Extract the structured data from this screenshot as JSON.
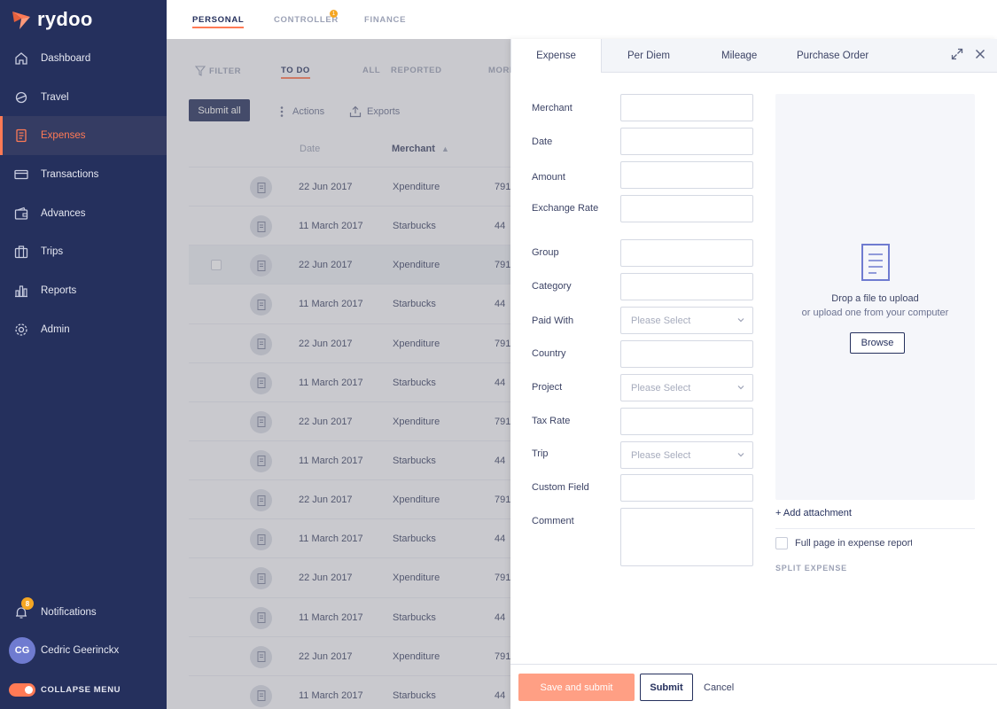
{
  "app": {
    "logo_text": "rydoo",
    "brand_color": "#ff7a55",
    "sidebar_color": "#25305d"
  },
  "sidebar": {
    "items": [
      {
        "label": "Dashboard",
        "icon": "home-icon"
      },
      {
        "label": "Travel",
        "icon": "travel-icon"
      },
      {
        "label": "Expenses",
        "icon": "expenses-icon",
        "active": true
      },
      {
        "label": "Transactions",
        "icon": "card-icon"
      },
      {
        "label": "Advances",
        "icon": "wallet-icon"
      },
      {
        "label": "Trips",
        "icon": "suitcase-icon"
      },
      {
        "label": "Reports",
        "icon": "bar-chart-icon"
      },
      {
        "label": "Admin",
        "icon": "gear-icon"
      }
    ],
    "notifications_label": "Notifications",
    "notifications_count": "8",
    "user_initials": "CG",
    "user_name": "Cedric Geerinckx",
    "collapse_label": "COLLAPSE MENU"
  },
  "top_tabs": [
    {
      "label": "PERSONAL",
      "active": true
    },
    {
      "label": "CONTROLLER",
      "badge": "1"
    },
    {
      "label": "FINANCE"
    }
  ],
  "list": {
    "filter_label": "FILTER",
    "subtabs": [
      "TO DO",
      "ALL",
      "REPORTED",
      "MORE"
    ],
    "submit_all": "Submit all",
    "actions": "Actions",
    "exports": "Exports",
    "columns": {
      "date": "Date",
      "merchant": "Merchant"
    },
    "rows": [
      {
        "date": "22 Jun 2017",
        "merchant": "Xpenditure",
        "amount": "791"
      },
      {
        "date": "11 March 2017",
        "merchant": "Starbucks",
        "amount": "44"
      },
      {
        "date": "22 Jun 2017",
        "merchant": "Xpenditure",
        "amount": "791"
      },
      {
        "date": "11 March 2017",
        "merchant": "Starbucks",
        "amount": "44"
      },
      {
        "date": "22 Jun 2017",
        "merchant": "Xpenditure",
        "amount": "791"
      },
      {
        "date": "11 March 2017",
        "merchant": "Starbucks",
        "amount": "44"
      },
      {
        "date": "22 Jun 2017",
        "merchant": "Xpenditure",
        "amount": "791"
      },
      {
        "date": "11 March 2017",
        "merchant": "Starbucks",
        "amount": "44"
      },
      {
        "date": "22 Jun 2017",
        "merchant": "Xpenditure",
        "amount": "791"
      },
      {
        "date": "11 March 2017",
        "merchant": "Starbucks",
        "amount": "44"
      },
      {
        "date": "22 Jun 2017",
        "merchant": "Xpenditure",
        "amount": "791"
      },
      {
        "date": "11 March 2017",
        "merchant": "Starbucks",
        "amount": "44"
      },
      {
        "date": "22 Jun 2017",
        "merchant": "Xpenditure",
        "amount": "791"
      },
      {
        "date": "11 March 2017",
        "merchant": "Starbucks",
        "amount": "44"
      }
    ]
  },
  "panel": {
    "tabs": [
      "Expense",
      "Per Diem",
      "Mileage",
      "Purchase Order"
    ],
    "fields": [
      {
        "label": "Merchant",
        "value": ""
      },
      {
        "label": "Date",
        "value": ""
      },
      {
        "label": "Amount",
        "value": ""
      },
      {
        "label": "Exchange Rate",
        "value": ""
      },
      {
        "label": "Group",
        "value": ""
      },
      {
        "label": "Category",
        "value": ""
      },
      {
        "label": "Paid With",
        "placeholder": "Please Select"
      },
      {
        "label": "Country",
        "value": ""
      },
      {
        "label": "Project",
        "placeholder": "Please Select"
      },
      {
        "label": "Tax Rate",
        "value": ""
      },
      {
        "label": "Trip",
        "placeholder": "Please Select"
      },
      {
        "label": "Custom Field",
        "value": ""
      },
      {
        "label": "Comment",
        "value": ""
      }
    ],
    "upload": {
      "title": "Drop a file to upload",
      "subtitle": "or upload one from your computer",
      "browse": "Browse"
    },
    "add_attachment": "+ Add attachment",
    "full_page": "Full page in expense report",
    "split_expense": "SPLIT EXPENSE",
    "footer": {
      "save_submit": "Save and submit",
      "submit": "Submit",
      "cancel": "Cancel"
    }
  }
}
